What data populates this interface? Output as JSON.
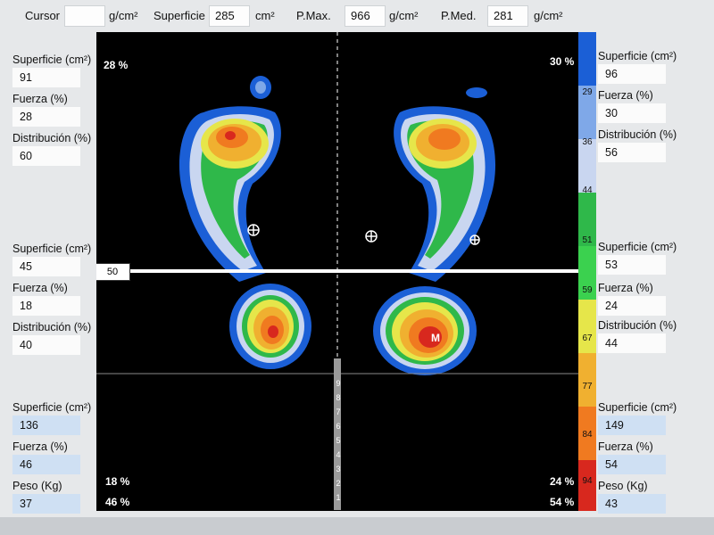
{
  "top": {
    "cursor_label": "Cursor",
    "cursor_value": "",
    "unit_pressure": "g/cm²",
    "superficie_label": "Superficie",
    "superficie_value": "285",
    "unit_area": "cm²",
    "pmax_label": "P.Max.",
    "pmax_value": "966",
    "pmed_label": "P.Med.",
    "pmed_value": "281"
  },
  "left": {
    "fore": {
      "superficie_label": "Superficie (cm²)",
      "superficie_value": "91",
      "fuerza_label": "Fuerza (%)",
      "fuerza_value": "28",
      "dist_label": "Distribución (%)",
      "dist_value": "60"
    },
    "rear": {
      "superficie_label": "Superficie (cm²)",
      "superficie_value": "45",
      "fuerza_label": "Fuerza (%)",
      "fuerza_value": "18",
      "dist_label": "Distribución (%)",
      "dist_value": "40"
    },
    "total": {
      "superficie_label": "Superficie (cm²)",
      "superficie_value": "136",
      "fuerza_label": "Fuerza (%)",
      "fuerza_value": "46",
      "peso_label": "Peso (Kg)",
      "peso_value": "37"
    }
  },
  "right": {
    "fore": {
      "superficie_label": "Superficie (cm²)",
      "superficie_value": "96",
      "fuerza_label": "Fuerza (%)",
      "fuerza_value": "30",
      "dist_label": "Distribución (%)",
      "dist_value": "56"
    },
    "rear": {
      "superficie_label": "Superficie (cm²)",
      "superficie_value": "53",
      "fuerza_label": "Fuerza (%)",
      "fuerza_value": "24",
      "dist_label": "Distribución (%)",
      "dist_value": "44"
    },
    "total": {
      "superficie_label": "Superficie (cm²)",
      "superficie_value": "149",
      "fuerza_label": "Fuerza (%)",
      "fuerza_value": "54",
      "peso_label": "Peso (Kg)",
      "peso_value": "43"
    }
  },
  "plot": {
    "left_fore_pct": "28 %",
    "right_fore_pct": "30 %",
    "left_rear_pct": "18 %",
    "right_rear_pct": "24 %",
    "left_total_pct": "46 %",
    "right_total_pct": "54 %",
    "divider_marker": "50",
    "peak_marker": "M",
    "center_scale_numbers": [
      "9",
      "8",
      "7",
      "6",
      "5",
      "4",
      "3",
      "2",
      "1"
    ]
  },
  "scale": {
    "ticks": [
      "29",
      "36",
      "44",
      "51",
      "59",
      "67",
      "77",
      "84",
      "94"
    ],
    "colors": [
      "#1b5fd6",
      "#7fa8e8",
      "#c9d6f0",
      "#2fb84a",
      "#3bd14f",
      "#e6e64a",
      "#f0b030",
      "#f07a20",
      "#d8281e"
    ]
  }
}
